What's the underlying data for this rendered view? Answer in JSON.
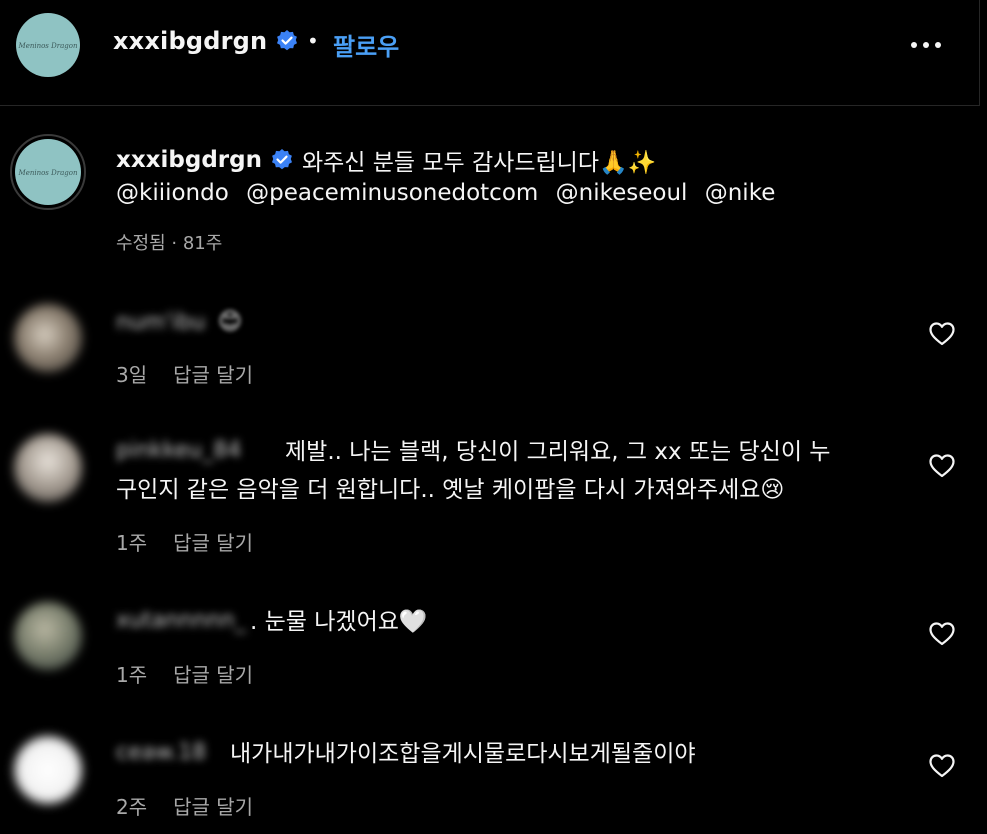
{
  "header": {
    "username": "xxxibgdrgn",
    "separator": "•",
    "follow_label": "팔로우",
    "more_icon": "more-horizontal-icon"
  },
  "caption": {
    "username": "xxxibgdrgn",
    "text": "와주신 분들 모두 감사드립니다🙏✨",
    "mentions": [
      "@kiiiondo",
      "@peaceminusonedotcom",
      "@nikeseoul",
      "@nike"
    ],
    "edited_label": "수정됨",
    "meta_separator": " · ",
    "time": "81주",
    "avatar_script": "Meninos Dragon"
  },
  "comments": [
    {
      "username": "num'ibu",
      "text": "",
      "emoji": "😊",
      "time": "3일",
      "reply_label": "답글 달기"
    },
    {
      "username": "pinkkeu_84",
      "line1": "제발.. 나는 블랙, 당신이 그리워요, 그 xx 또는 당신이 누",
      "line2": "구인지 같은 음악을 더 원합니다.. 옛날 케이팝을 다시 가져와주세요😢",
      "time": "1주",
      "reply_label": "답글 달기"
    },
    {
      "username": "xutannnnn_",
      "text": ". 눈물 나겠어요🤍",
      "time": "1주",
      "reply_label": "답글 달기"
    },
    {
      "username": "ceaw.18",
      "text": "내가내가내가이조합을게시물로다시보게될줄이야",
      "time": "2주",
      "reply_label": "답글 달기"
    }
  ],
  "colors": {
    "background": "#000000",
    "text": "#f5f5f5",
    "muted": "#a8a8a8",
    "follow": "#4a9ff5",
    "verified": "#3b82f6",
    "avatar_teal": "#8fc3c3"
  }
}
